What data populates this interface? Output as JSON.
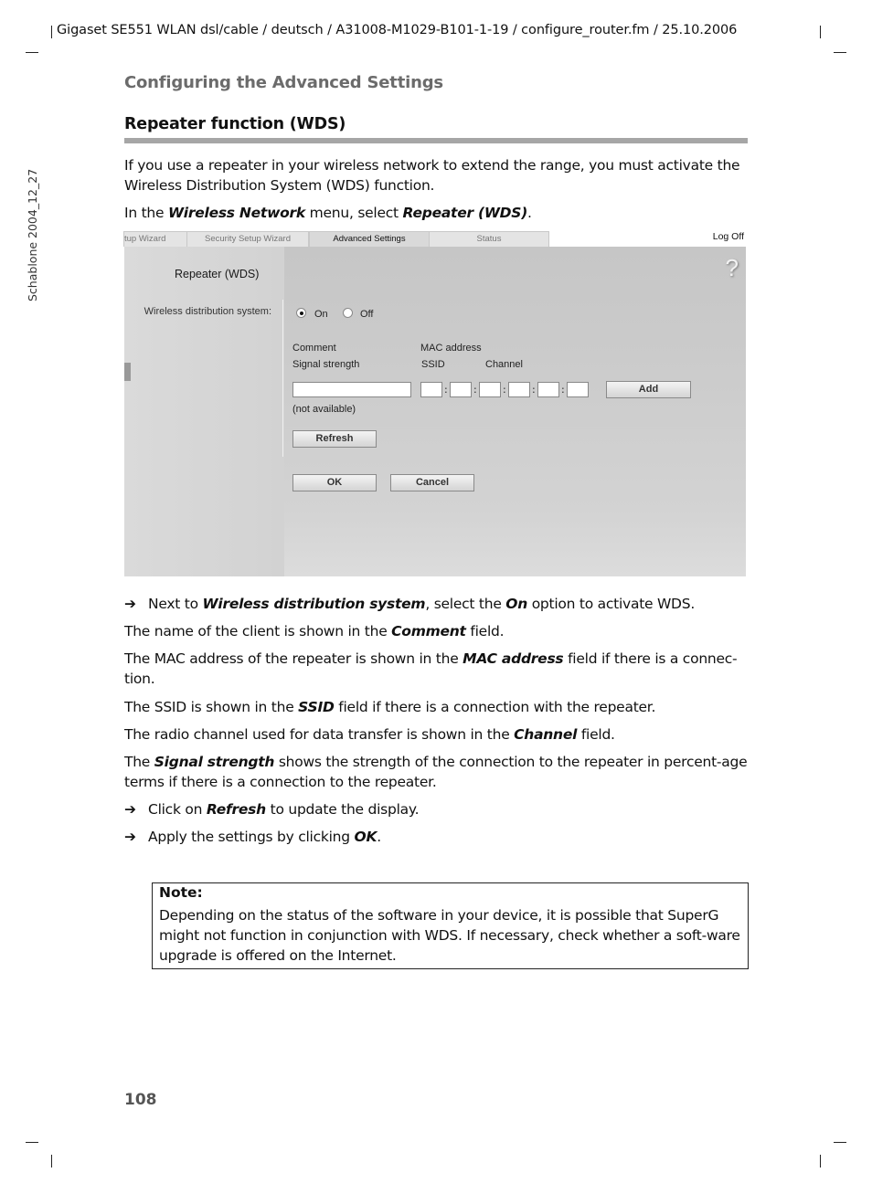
{
  "header": {
    "doc_line": "Gigaset SE551 WLAN dsl/cable / deutsch / A31008-M1029-B101-1-19 / configure_router.fm / 25.10.2006",
    "side_label": "Schablone 2004_12_27"
  },
  "chapter_title": "Configuring the Advanced Settings",
  "section_title": "Repeater function (WDS)",
  "intro": {
    "p1": "If you use a repeater in your wireless network to extend the range, you must activate the Wireless Distribution System (WDS) function.",
    "p2_pre": "In the ",
    "p2_em1": "Wireless Network",
    "p2_mid": " menu, select ",
    "p2_em2": "Repeater (WDS)",
    "p2_post": "."
  },
  "screenshot": {
    "tabs": [
      "tup Wizard",
      "Security Setup Wizard",
      "Advanced Settings",
      "Status"
    ],
    "active_tab": "Advanced Settings",
    "logoff": "Log Off",
    "help_icon": "?",
    "panel_title": "Repeater (WDS)",
    "wds_label": "Wireless distribution system:",
    "radio_on": "On",
    "radio_off": "Off",
    "wds_selected": "On",
    "col_comment": "Comment",
    "col_signal": "Signal strength",
    "col_mac": "MAC address",
    "col_ssid": "SSID",
    "col_channel": "Channel",
    "comment_value": "",
    "mac_values": [
      "",
      "",
      "",
      "",
      "",
      ""
    ],
    "not_available": "(not available)",
    "add_button": "Add",
    "refresh_button": "Refresh",
    "ok_button": "OK",
    "cancel_button": "Cancel"
  },
  "steps": {
    "s1_pre": "Next to ",
    "s1_em1": "Wireless distribution system",
    "s1_mid": ", select the ",
    "s1_em2": "On",
    "s1_post": " option to activate WDS.",
    "p_comment_pre": "The name of the client is shown in the ",
    "p_comment_em": "Comment",
    "p_comment_post": " field.",
    "p_mac_pre": "The MAC address of the repeater is shown in the ",
    "p_mac_em": "MAC address",
    "p_mac_post": " field if there is a connec-tion.",
    "p_ssid_pre": "The SSID is shown in the ",
    "p_ssid_em": "SSID",
    "p_ssid_post": " field if there is a connection with the repeater.",
    "p_channel_pre": "The radio channel used for data transfer is shown in the ",
    "p_channel_em": "Channel",
    "p_channel_post": " field.",
    "p_signal_pre": "The ",
    "p_signal_em": "Signal strength",
    "p_signal_post": " shows the strength of the connection to the repeater in percent-age terms if there is a connection to the repeater.",
    "s2_pre": "Click on ",
    "s2_em": "Refresh",
    "s2_post": " to update the display.",
    "s3_pre": "Apply the settings by clicking ",
    "s3_em": "OK",
    "s3_post": ".",
    "arrow": "➔"
  },
  "note": {
    "title": "Note:",
    "body": "Depending on the status of the software in your device, it is possible that SuperG might not function in conjunction with WDS. If necessary, check whether a soft-ware upgrade is offered on the Internet."
  },
  "page_number": "108"
}
